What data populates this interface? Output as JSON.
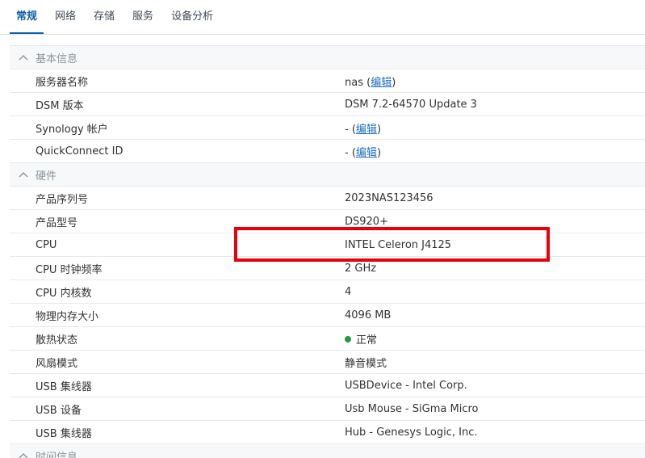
{
  "tabs": [
    {
      "label": "常规",
      "active": true
    },
    {
      "label": "网络",
      "active": false
    },
    {
      "label": "存储",
      "active": false
    },
    {
      "label": "服务",
      "active": false
    },
    {
      "label": "设备分析",
      "active": false
    }
  ],
  "sections": {
    "basic": {
      "title": "基本信息",
      "rows": {
        "server_name": {
          "label": "服务器名称",
          "value": "nas",
          "edit": "编辑"
        },
        "dsm_version": {
          "label": "DSM 版本",
          "value": "DSM 7.2-64570 Update 3"
        },
        "synology_account": {
          "label": "Synology 帐户",
          "value": "-",
          "edit": "编辑"
        },
        "quickconnect_id": {
          "label": "QuickConnect ID",
          "value": "-",
          "edit": "编辑"
        }
      }
    },
    "hardware": {
      "title": "硬件",
      "rows": {
        "serial": {
          "label": "产品序列号",
          "value": "2023NAS123456"
        },
        "model": {
          "label": "产品型号",
          "value": "DS920+"
        },
        "cpu": {
          "label": "CPU",
          "value": "INTEL Celeron J4125"
        },
        "cpu_clock": {
          "label": "CPU 时钟频率",
          "value": "2 GHz"
        },
        "cpu_cores": {
          "label": "CPU 内核数",
          "value": "4"
        },
        "memory": {
          "label": "物理内存大小",
          "value": "4096 MB"
        },
        "thermal": {
          "label": "散热状态",
          "value": "正常"
        },
        "fan_mode": {
          "label": "风扇模式",
          "value": "静音模式"
        },
        "usb_hub_1": {
          "label": "USB 集线器",
          "value": "USBDevice - Intel Corp."
        },
        "usb_device": {
          "label": "USB 设备",
          "value": "Usb Mouse - SiGma Micro"
        },
        "usb_hub_2": {
          "label": "USB 集线器",
          "value": "Hub - Genesys Logic, Inc."
        }
      }
    },
    "time": {
      "title": "时间信息"
    }
  },
  "colors": {
    "accent": "#0f5fa8",
    "link": "#1a6fc4",
    "status_ok": "#1f9d3a",
    "highlight": "#e8000b"
  }
}
